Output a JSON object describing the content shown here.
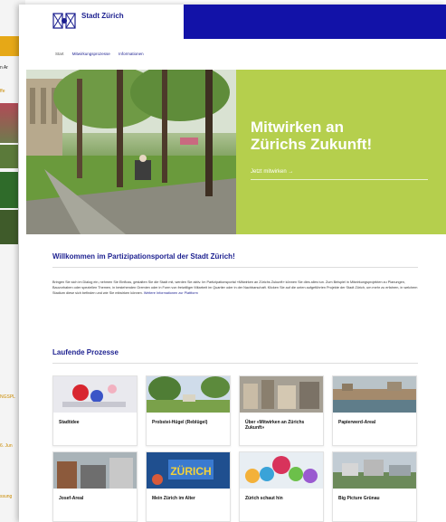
{
  "background_page": {
    "nav_fragment": "n Ar",
    "link_fragment": "ffe",
    "strip_1": "NGSPL",
    "strip_2": "6. Jun",
    "strip_3": "ssung"
  },
  "header": {
    "brand": "Stadt Zürich",
    "logo_icon": "zurich-coat-of-arms-icon",
    "brand_color": "#1212a8"
  },
  "breadcrumb": [
    "Start",
    "Mitwirkungsprozesse",
    "Informationen"
  ],
  "hero": {
    "title_line1": "Mitwirken an",
    "title_line2": "Zürichs Zukunft!",
    "cta": "Jetzt mitwirken  →",
    "panel_color": "#b5cf4d"
  },
  "welcome": {
    "title": "Willkommen im Partizipationsportal der Stadt Zürich!",
    "text": "Bringen Sie sich im Dialog ein, nehmen Sie Einfluss, gestalten Sie die Stadt mit, werden Sie aktiv. Im Partizipationsportal «Mitwirken an Zürichs Zukunft» können Sie dies alles tun. Zum Beispiel in Mitwirkungsprojekten zu Planungen, Bauvorhaben oder speziellen Themen, in bestehenden Gremien oder in Form von freiwilliger Mitarbeit im Quartier oder in der Nachbarschaft. Klicken Sie auf die unten aufgeführten Projekte der Stadt Zürich, um mehr zu erfahren, in welchem Stadium diese sich befinden und wie Sie mitwirken können.",
    "more_link": "Weitere Informationen zur Plattform"
  },
  "processes": {
    "title": "Laufende Prozesse",
    "cards": [
      {
        "label": "Stadtidee"
      },
      {
        "label": "Probstei-Hügel (Reblügel)"
      },
      {
        "label": "Über «Mitwirken an Zürichs Zukunft»"
      },
      {
        "label": "Papierwerd-Areal"
      },
      {
        "label": "Josef-Areal"
      },
      {
        "label": "Mein Zürich im Alter"
      },
      {
        "label": "Zürich schaut hin"
      },
      {
        "label": "Big Picture Grünau"
      }
    ]
  }
}
